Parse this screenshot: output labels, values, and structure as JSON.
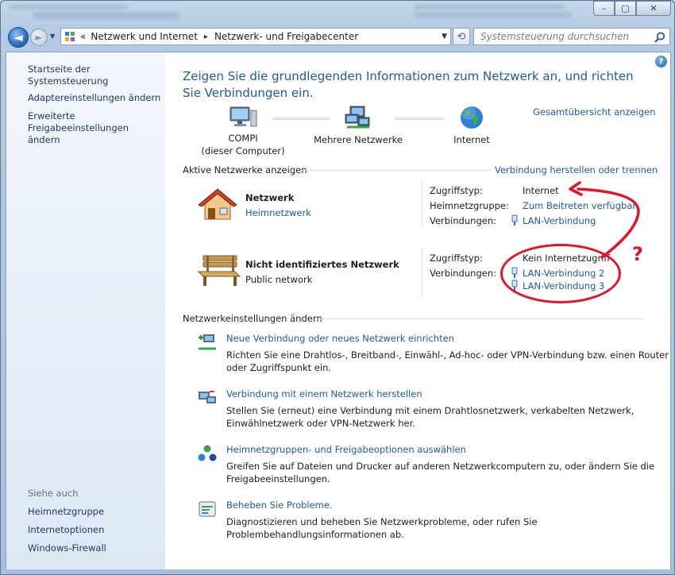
{
  "window": {
    "controls": {
      "minimize": "–",
      "maximize": "▢",
      "close": "✕"
    }
  },
  "nav": {
    "back_glyph": "◄",
    "forward_glyph": "►",
    "breadcrumb": [
      "Netzwerk und Internet",
      "Netzwerk- und Freigabecenter"
    ],
    "overflow": "«",
    "separator": "▸",
    "search_placeholder": "Systemsteuerung durchsuchen"
  },
  "sidebar": {
    "items": [
      {
        "label": "Startseite der Systemsteuerung"
      },
      {
        "label": "Adaptereinstellungen ändern"
      },
      {
        "label": "Erweiterte Freigabeeinstellungen ändern"
      }
    ],
    "see_also_title": "Siehe auch",
    "see_also": [
      {
        "label": "Heimnetzgruppe"
      },
      {
        "label": "Internetoptionen"
      },
      {
        "label": "Windows-Firewall"
      }
    ]
  },
  "main": {
    "heading": "Zeigen Sie die grundlegenden Informationen zum Netzwerk an, und richten Sie Verbindungen ein.",
    "full_map_link": "Gesamtübersicht anzeigen",
    "map": {
      "computer": {
        "line1": "COMPI",
        "line2": "(dieser Computer)"
      },
      "networks": "Mehrere Netzwerke",
      "internet": "Internet"
    },
    "active_title": "Aktive Netzwerke anzeigen",
    "connect_link": "Verbindung herstellen oder trennen",
    "networks": [
      {
        "name": "Netzwerk",
        "type": "Heimnetzwerk",
        "access_label": "Zugriffstyp:",
        "access_value": "Internet",
        "homegroup_label": "Heimnetzgruppe:",
        "homegroup_value": "Zum Beitreten verfügbar",
        "connections_label": "Verbindungen:",
        "connections": [
          "LAN-Verbindung"
        ]
      },
      {
        "name": "Nicht identifiziertes Netzwerk",
        "type": "Public network",
        "access_label": "Zugriffstyp:",
        "access_value": "Kein Internetzugriff",
        "connections_label": "Verbindungen:",
        "connections": [
          "LAN-Verbindung 2",
          "LAN-Verbindung 3"
        ]
      }
    ],
    "settings_title": "Netzwerkeinstellungen ändern",
    "tasks": [
      {
        "title": "Neue Verbindung oder neues Netzwerk einrichten",
        "desc1": "Richten Sie eine Drahtlos-, Breitband-, Einwähl-, Ad-hoc- oder VPN-Verbindung bzw. einen Router",
        "desc2": "oder Zugriffspunkt ein."
      },
      {
        "title": "Verbindung mit einem Netzwerk herstellen",
        "desc1": "Stellen Sie (erneut) eine Verbindung mit einem Drahtlosnetzwerk, verkabelten Netzwerk,",
        "desc2": "Einwählnetzwerk oder VPN-Netzwerk her."
      },
      {
        "title": "Heimnetzgruppen- und Freigabeoptionen auswählen",
        "desc1": "Greifen Sie auf Dateien und Drucker auf anderen Netzwerkcomputern zu, oder ändern Sie die",
        "desc2": "Freigabeeinstellungen."
      },
      {
        "title": "Beheben Sie Probleme.",
        "desc1": "Diagnostizieren und beheben Sie Netzwerkprobleme, oder rufen Sie",
        "desc2": "Problembehandlungsinformationen ab."
      }
    ]
  },
  "annotation": {
    "question_mark": "?",
    "color": "#e3132a"
  }
}
